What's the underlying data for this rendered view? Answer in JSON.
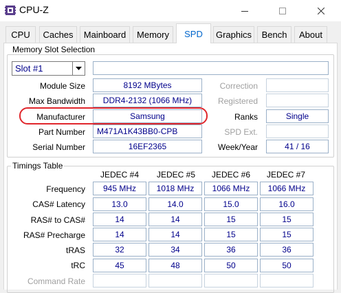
{
  "window": {
    "title": "CPU-Z",
    "icon": "cpu-z-app-icon",
    "controls": {
      "minimize": "minimize-icon",
      "maximize": "maximize-icon",
      "close": "close-icon"
    }
  },
  "tabs": [
    {
      "label": "CPU"
    },
    {
      "label": "Caches"
    },
    {
      "label": "Mainboard"
    },
    {
      "label": "Memory"
    },
    {
      "label": "SPD",
      "active": true
    },
    {
      "label": "Graphics"
    },
    {
      "label": "Bench"
    },
    {
      "label": "About"
    }
  ],
  "memory_slot": {
    "group_title": "Memory Slot Selection",
    "slot_selected": "Slot #1",
    "memory_type": "DDR4",
    "labels": {
      "module_size": "Module Size",
      "max_bandwidth": "Max Bandwidth",
      "manufacturer": "Manufacturer",
      "part_number": "Part Number",
      "serial_number": "Serial Number",
      "correction": "Correction",
      "registered": "Registered",
      "ranks": "Ranks",
      "spd_ext": "SPD Ext.",
      "week_year": "Week/Year"
    },
    "values": {
      "module_size": "8192 MBytes",
      "max_bandwidth": "DDR4-2132 (1066 MHz)",
      "manufacturer": "Samsung",
      "part_number": "M471A1K43BB0-CPB",
      "serial_number": "16EF2365",
      "correction": "",
      "registered": "",
      "ranks": "Single",
      "spd_ext": "",
      "week_year": "41 / 16"
    }
  },
  "timings": {
    "group_title": "Timings Table",
    "columns": [
      "JEDEC #4",
      "JEDEC #5",
      "JEDEC #6",
      "JEDEC #7"
    ],
    "rows": [
      {
        "label": "Frequency",
        "values": [
          "945 MHz",
          "1018 MHz",
          "1066 MHz",
          "1066 MHz"
        ]
      },
      {
        "label": "CAS# Latency",
        "values": [
          "13.0",
          "14.0",
          "15.0",
          "16.0"
        ]
      },
      {
        "label": "RAS# to CAS#",
        "values": [
          "14",
          "14",
          "15",
          "15"
        ]
      },
      {
        "label": "RAS# Precharge",
        "values": [
          "14",
          "14",
          "15",
          "15"
        ]
      },
      {
        "label": "tRAS",
        "values": [
          "32",
          "34",
          "36",
          "36"
        ]
      },
      {
        "label": "tRC",
        "values": [
          "45",
          "48",
          "50",
          "50"
        ]
      },
      {
        "label": "Command Rate",
        "values": [
          "",
          "",
          "",
          ""
        ],
        "disabled": true
      }
    ]
  },
  "colors": {
    "value_text": "#00008b",
    "active_tab_text": "#0066cc",
    "highlight": "#e0252b"
  }
}
